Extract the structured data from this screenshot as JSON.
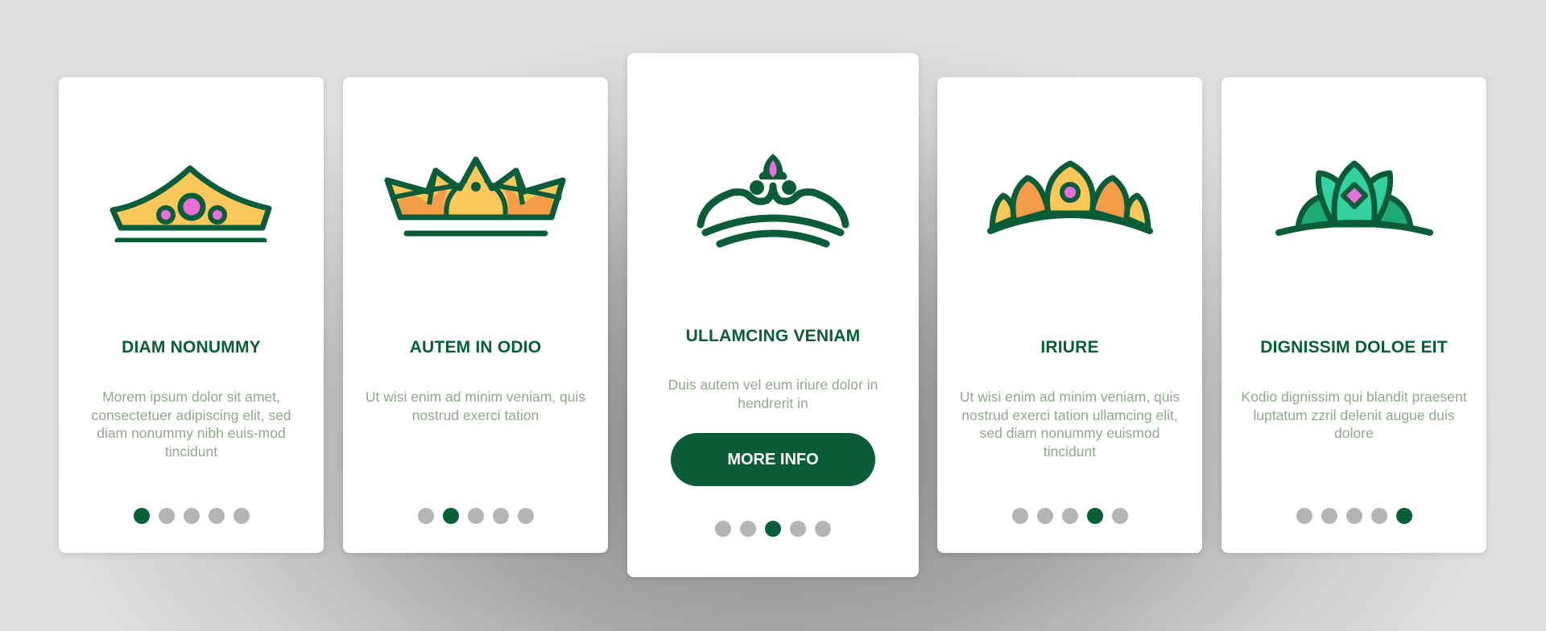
{
  "colors": {
    "primary": "#0b5c38",
    "description_text": "#93a68f",
    "dot_inactive": "#b4b4b4",
    "gold": "#f9c75a",
    "orange": "#f59c48",
    "gem_pink": "#e86fd8",
    "teal_light": "#35d0a0",
    "teal_dark": "#1fa878"
  },
  "total_pages": 5,
  "cards": [
    {
      "icon": "crown-gems-icon",
      "title": "DIAM NONUMMY",
      "description": "Morem ipsum dolor sit amet, consectetuer adipiscing elit, sed diam nonummy nibh euis-mod tincidunt",
      "active_page": 1
    },
    {
      "icon": "crown-petals-icon",
      "title": "AUTEM IN ODIO",
      "description": "Ut wisi enim ad minim veniam, quis nostrud exerci tation",
      "active_page": 2
    },
    {
      "icon": "tiara-outline-icon",
      "title": "ULLAMCING VENIAM",
      "description": "Duis autem vel eum iriure dolor in hendrerit in",
      "button_label": "MORE INFO",
      "active_page": 3
    },
    {
      "icon": "tiara-leaves-icon",
      "title": "IRIURE",
      "description": "Ut wisi enim ad minim veniam, quis nostrud exerci tation ullamcing elit, sed diam nonummy euismod tincidunt",
      "active_page": 4
    },
    {
      "icon": "tiara-teal-icon",
      "title": "DIGNISSIM DOLOE EIT",
      "description": "Kodio dignissim qui blandit praesent luptatum zzril delenit augue duis dolore",
      "active_page": 5
    }
  ]
}
